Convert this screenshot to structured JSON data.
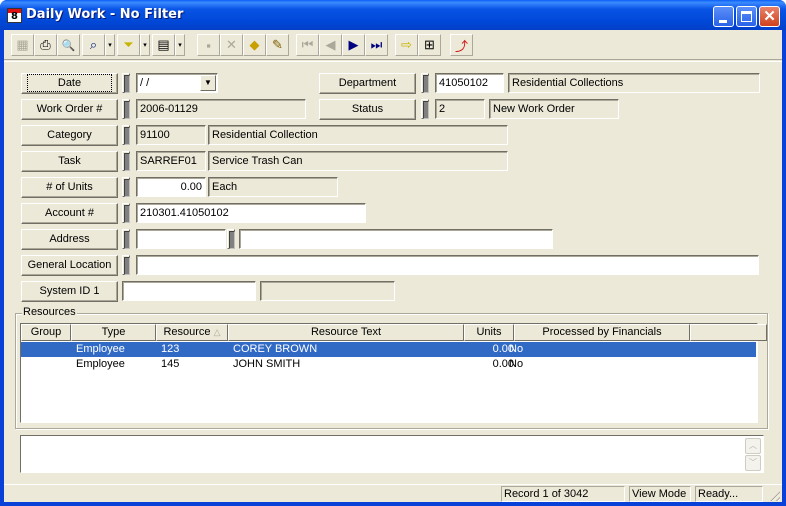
{
  "window": {
    "title": "Daily Work - No Filter",
    "title_icon_glyph": "8",
    "controls": {
      "minimize": "_",
      "maximize": "□",
      "close": "✕"
    }
  },
  "toolbar": {
    "buttons": [
      {
        "name": "form-view-icon",
        "glyph": "▦",
        "enabled": false
      },
      {
        "name": "print-icon",
        "glyph": "⎙",
        "enabled": true
      },
      {
        "name": "print-preview-icon",
        "glyph": "🔍",
        "enabled": true
      },
      {
        "name": "find-icon",
        "glyph": "⌕",
        "enabled": true
      },
      {
        "name": "filter-icon",
        "glyph": "⏷",
        "enabled": true
      },
      {
        "name": "report-icon",
        "glyph": "▤",
        "enabled": true
      },
      {
        "name": "save-icon",
        "glyph": "▪",
        "enabled": false
      },
      {
        "name": "delete-icon",
        "glyph": "✕",
        "enabled": false
      },
      {
        "name": "new-record-icon",
        "glyph": "◆",
        "enabled": true
      },
      {
        "name": "edit-icon",
        "glyph": "✎",
        "enabled": true
      },
      {
        "name": "first-record-icon",
        "glyph": "⏮",
        "enabled": false
      },
      {
        "name": "previous-record-icon",
        "glyph": "◀",
        "enabled": false
      },
      {
        "name": "next-record-icon",
        "glyph": "▶",
        "enabled": true
      },
      {
        "name": "last-record-icon",
        "glyph": "⏭",
        "enabled": true
      },
      {
        "name": "goto-icon",
        "glyph": "⇨",
        "enabled": true
      },
      {
        "name": "hierarchy-icon",
        "glyph": "⊞",
        "enabled": true
      },
      {
        "name": "exit-icon",
        "glyph": "⤴",
        "enabled": true
      }
    ],
    "dropdown_glyph": "▾"
  },
  "form": {
    "date": {
      "label": "Date",
      "value": " /  /",
      "arrow": "▼"
    },
    "work_order": {
      "label": "Work Order #",
      "value": "2006-01129"
    },
    "category": {
      "label": "Category",
      "code": "91100",
      "description": "Residential Collection"
    },
    "task": {
      "label": "Task",
      "code": "SARREF01",
      "description": "Service Trash Can"
    },
    "units": {
      "label": "# of Units",
      "value": "0.00",
      "unit": "Each"
    },
    "account": {
      "label": "Account #",
      "value": "210301.41050102"
    },
    "address": {
      "label": "Address",
      "number": "",
      "street": ""
    },
    "general_location": {
      "label": "General Location",
      "value": ""
    },
    "system_id": {
      "label": "System ID 1",
      "value": "",
      "extra": ""
    },
    "department": {
      "label": "Department",
      "code": "41050102",
      "description": "Residential Collections"
    },
    "status": {
      "label": "Status",
      "code": "2",
      "description": "New Work Order"
    }
  },
  "resources": {
    "group_label": "Resources",
    "columns": [
      "Group",
      "Type",
      "Resource",
      "Resource Text",
      "Units",
      "Processed by Financials",
      ""
    ],
    "sort_indicator": "△",
    "rows": [
      {
        "group": "",
        "type": "Employee",
        "resource": "123",
        "text": "COREY BROWN",
        "units": "0.00",
        "processed": "No",
        "selected": true
      },
      {
        "group": "",
        "type": "Employee",
        "resource": "145",
        "text": "JOHN SMITH",
        "units": "0.00",
        "processed": "No",
        "selected": false
      }
    ]
  },
  "memo": {
    "value": "",
    "scroll_up": "︿",
    "scroll_down": "﹀"
  },
  "statusbar": {
    "record": "Record 1 of 3042",
    "mode": "View Mode",
    "state": "Ready..."
  },
  "colors": {
    "selection": "#316ac5",
    "titlebar": "#0a55e6",
    "face": "#ece9d8"
  }
}
